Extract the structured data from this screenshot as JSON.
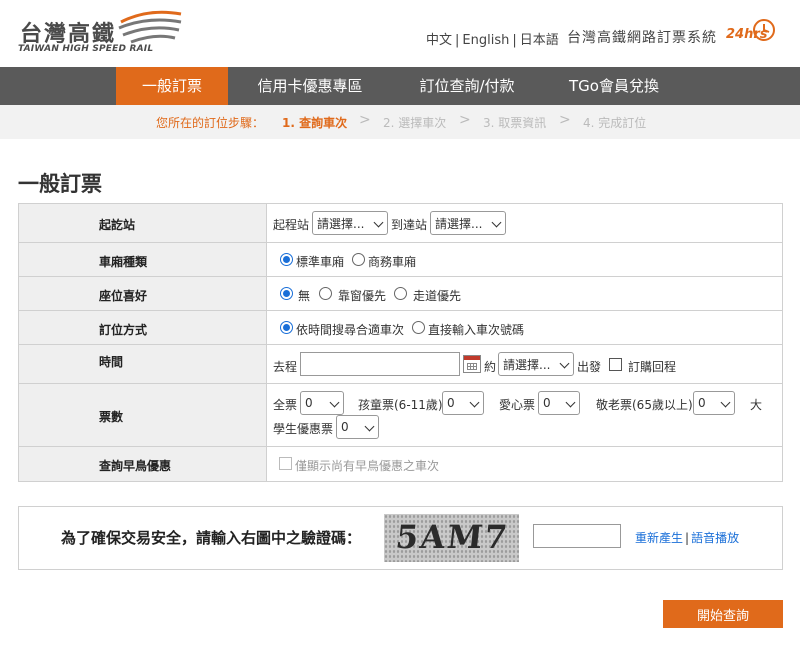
{
  "brand": {
    "name_cn": "台灣高鐵",
    "name_en": "TAIWAN HIGH SPEED RAIL"
  },
  "languages": [
    "中文",
    "English",
    "日本語"
  ],
  "system_title": "台灣高鐵網路訂票系統",
  "badge_24": "24hrs",
  "nav": [
    "一般訂票",
    "信用卡優惠專區",
    "訂位查詢/付款",
    "TGo會員兌換"
  ],
  "steps": {
    "label": "您所在的訂位步驟：",
    "items": [
      "1. 查詢車次",
      "2. 選擇車次",
      "3. 取票資訊",
      "4. 完成訂位"
    ],
    "sep": ">"
  },
  "page_title": "一般訂票",
  "form": {
    "station": {
      "label": "起訖站",
      "from_label": "起程站",
      "from_value": "請選擇...",
      "to_label": "到達站",
      "to_value": "請選擇..."
    },
    "car": {
      "label": "車廂種類",
      "opt1": "標準車廂",
      "opt2": "商務車廂"
    },
    "seat": {
      "label": "座位喜好",
      "opt1": "無",
      "opt2": "靠窗優先",
      "opt3": "走道優先"
    },
    "method": {
      "label": "訂位方式",
      "opt1": "依時間搜尋合適車次",
      "opt2": "直接輸入車次號碼"
    },
    "time": {
      "label": "時間",
      "go_label": "去程",
      "date_value": "",
      "about": "約",
      "time_value": "請選擇...",
      "depart": "出發",
      "return_label": "訂購回程"
    },
    "tickets": {
      "label": "票數",
      "adult": "全票",
      "adult_val": "0",
      "child": "孩童票(6-11歲)",
      "child_val": "0",
      "disabled": "愛心票",
      "disabled_val": "0",
      "elder": "敬老票(65歲以上)",
      "elder_val": "0",
      "student_a": "大",
      "student_b": "學生優惠票",
      "student_val": "0"
    },
    "early": {
      "label": "查詢早鳥優惠",
      "check": "僅顯示尚有早鳥優惠之車次"
    }
  },
  "captcha": {
    "question": "為了確保交易安全，請輸入右圖中之驗證碼：",
    "image_text": "5AM7",
    "input_value": "",
    "regen": "重新產生",
    "audio": "語音播放",
    "sep": "|"
  },
  "submit": "開始查詢",
  "colors": {
    "accent": "#e06a1b",
    "nav_bg": "#5a5a5a",
    "link": "#1a6fd8"
  }
}
